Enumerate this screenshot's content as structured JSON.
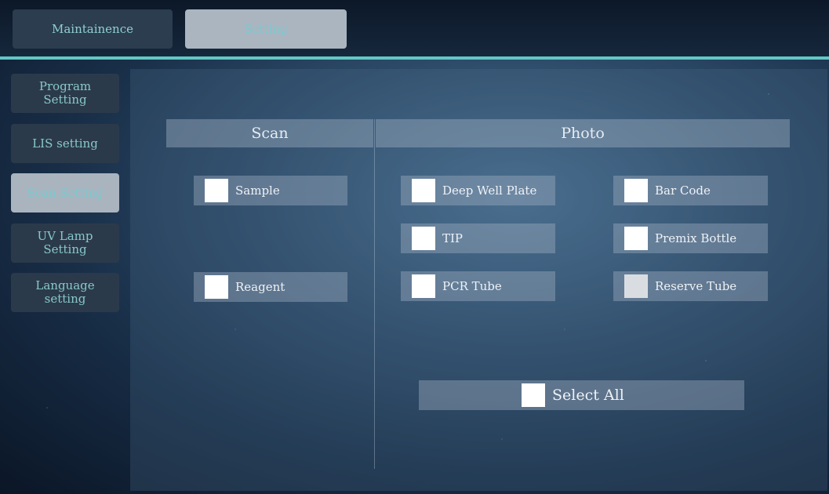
{
  "top_tabs": {
    "maintainence": "Maintainence",
    "setting": "Setting"
  },
  "sidebar": {
    "items": [
      {
        "label": "Program\nSetting"
      },
      {
        "label": "LIS setting"
      },
      {
        "label": "Scan Setting"
      },
      {
        "label": "UV Lamp\nSetting"
      },
      {
        "label": "Language\nsetting"
      }
    ],
    "active": "Scan Setting"
  },
  "sections": {
    "scan_title": "Scan",
    "photo_title": "Photo"
  },
  "scan_options": {
    "sample": "Sample",
    "reagent": "Reagent"
  },
  "photo_options": {
    "deep_well_plate": "Deep Well Plate",
    "bar_code": "Bar Code",
    "tip": "TIP",
    "premix_bottle": "Premix Bottle",
    "pcr_tube": "PCR Tube",
    "reserve_tube": "Reserve Tube"
  },
  "select_all": "Select All",
  "colors": {
    "accent": "#62c7c4",
    "tab_text": "#8fcfd0"
  }
}
